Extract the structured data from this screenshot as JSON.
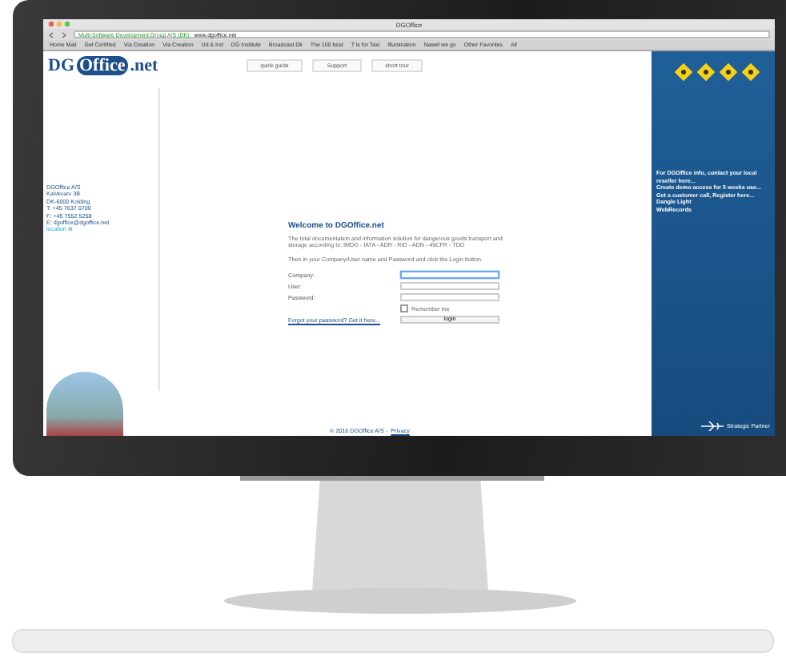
{
  "browser": {
    "title": "DGOffice",
    "identity": "Multi-Software Development Group A/S (DK)",
    "url": "www.dgoffice.net",
    "bookmarks": [
      "Home Mail",
      "Get Certified",
      "Via Creation",
      "Via Creation",
      "Ud & Ind",
      "DG Institute",
      "Broadcast Dk",
      "The 100 best",
      "T is for Taxi",
      "Illumination",
      "Nawel we go",
      "Other Favorites",
      "All"
    ]
  },
  "header": {
    "logo_left": "DG",
    "logo_mid": "Office",
    "logo_right": ".net",
    "nav": [
      "quick guide",
      "Support",
      "short tour"
    ]
  },
  "contact": [
    {
      "kind": "text",
      "text": "DGOffice A/S"
    },
    {
      "kind": "text",
      "text": "Kalvkvarv 3B"
    },
    {
      "kind": "text",
      "text": "DK-6000 Kolding"
    },
    {
      "kind": "text",
      "text": "T: +45 7637 0700"
    },
    {
      "kind": "text",
      "text": "F: +45 7552 5258"
    },
    {
      "kind": "text",
      "text": "E: dgoffice@dgoffice.net"
    },
    {
      "kind": "link",
      "text": "location ⊕"
    }
  ],
  "login": {
    "title": "Welcome to DGOffice.net",
    "intro": "The total documentation and information solution for dangerous goods transport and storage according to: IMDG - IATA - ADR - RID - ADN - 49CFR - TDG",
    "hint": "Then in your Company/User name and Password and click the Login button.",
    "fields": [
      {
        "label": "Company:",
        "focused": true
      },
      {
        "label": "User:",
        "focused": false
      },
      {
        "label": "Password:",
        "focused": false
      }
    ],
    "remember": {
      "label": "Remember me",
      "checked": false
    },
    "forgot": "Forgot your password? Get it here...",
    "button": "login"
  },
  "footer": {
    "copyright": "© 2016 DGOffice A/S -",
    "privacy": "Privacy"
  },
  "sidebar": {
    "links": [
      "For DGOffice info, contact your local reseller here...",
      "Create demo access for 5 weeks use...",
      "Get a customer call, Register here...",
      "Dangle Light",
      "WebRecords"
    ],
    "partner": "Strategic Partner"
  }
}
